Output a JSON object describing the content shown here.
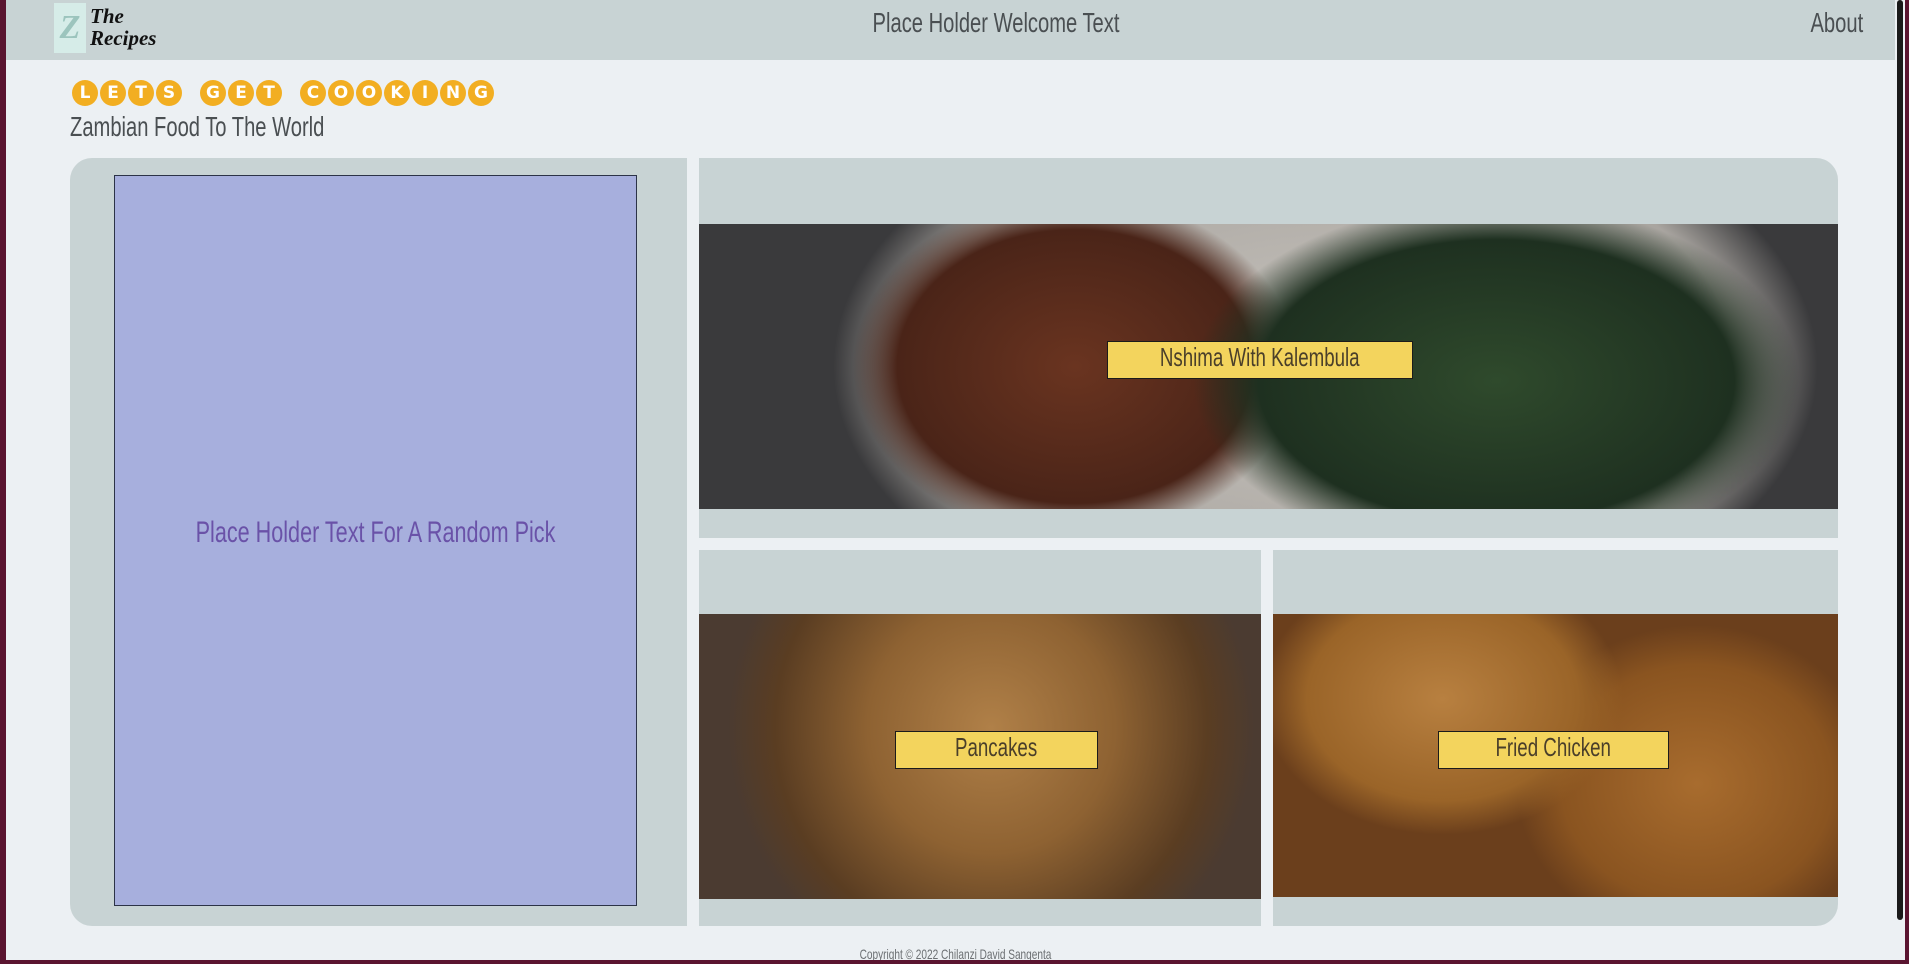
{
  "header": {
    "logo_mark": "Z",
    "logo_line1": "The",
    "logo_line2": "Recipes",
    "welcome_text": "Place Holder Welcome Text",
    "about_link": "About"
  },
  "hero": {
    "title": "LETS GET COOKING",
    "subtitle": "Zambian Food To The World"
  },
  "random_pick": {
    "text": "Place Holder Text For A Random Pick"
  },
  "recipes": [
    {
      "name": "Nshima With Kalembula"
    },
    {
      "name": "Pancakes"
    },
    {
      "name": "Fried Chicken"
    }
  ],
  "footer": {
    "copyright": "Copyright © 2022 Chilanzi David Sangenta"
  },
  "colors": {
    "accent": "#f2ae21",
    "label_bg": "#f3d45d",
    "panel_bg": "#c8d3d4",
    "random_card_bg": "#a7afdd"
  }
}
